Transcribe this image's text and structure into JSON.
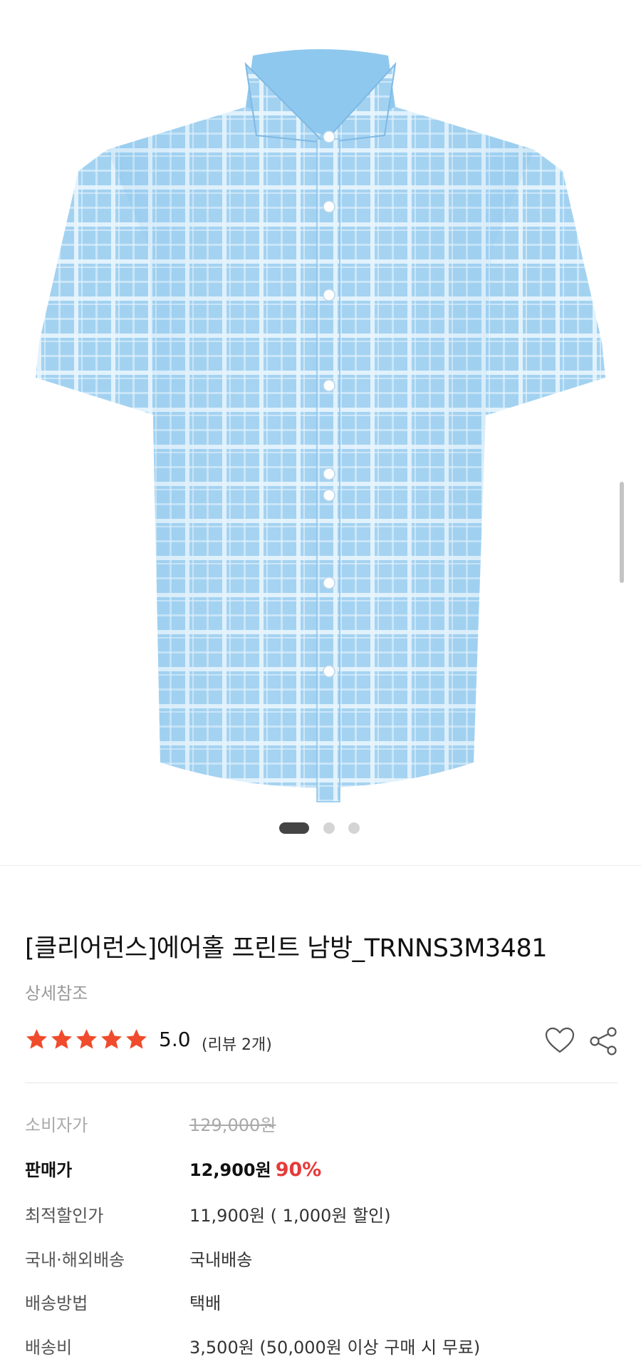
{
  "gallery": {
    "image_icon": "plaid-short-sleeve-shirt",
    "slide_count": 3,
    "active_slide": 1
  },
  "product": {
    "title": "[클리어런스]에어홀 프린트 남방_TRNNS3M3481",
    "subtitle": "상세참조",
    "rating": "5.0",
    "review_count": "(리뷰 2개)",
    "stars": 5,
    "star_color": "#f04b2c",
    "icons": {
      "wishlist": "heart-outline-icon",
      "share": "share-icon"
    }
  },
  "specs": {
    "msrp_label": "소비자가",
    "msrp_value": "129,000원",
    "sale_label": "판매가",
    "sale_price": "12,900원",
    "discount_rate": "90%",
    "discount_color": "#e63b3b",
    "best_label": "최적할인가",
    "best_value": "11,900원 ( 1,000원 할인)",
    "shipping_region_label": "국내·해외배송",
    "shipping_region_value": "국내배송",
    "shipping_method_label": "배송방법",
    "shipping_method_value": "택배",
    "shipping_fee_label": "배송비",
    "shipping_fee_value": "3,500원 (50,000원 이상 구매 시 무료)"
  }
}
